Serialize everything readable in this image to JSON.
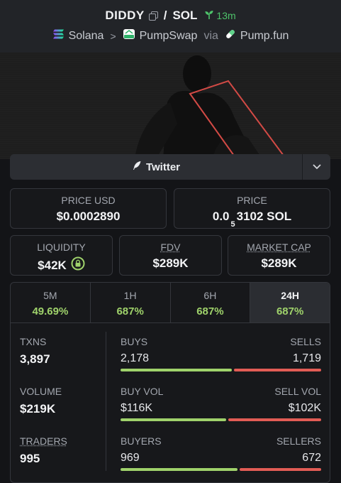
{
  "header": {
    "base_token": "DIDDY",
    "separator": "/",
    "quote_token": "SOL",
    "age": "13m",
    "chain": "Solana",
    "dex": "PumpSwap",
    "via": "via",
    "launchpad": "Pump.fun",
    "colors": {
      "age": "#4ec26a"
    }
  },
  "links": {
    "twitter_label": "Twitter"
  },
  "price_usd": {
    "label": "PRICE USD",
    "value": "$0.0002890"
  },
  "price": {
    "label": "PRICE",
    "value_prefix": "0.0",
    "value_sub": "5",
    "value_suffix": "3102 SOL"
  },
  "liquidity": {
    "label": "LIQUIDITY",
    "value": "$42K"
  },
  "fdv": {
    "label": "FDV",
    "value": "$289K"
  },
  "market_cap": {
    "label": "MARKET CAP",
    "value": "$289K"
  },
  "timeframes": [
    {
      "label": "5M",
      "change": "49.69%"
    },
    {
      "label": "1H",
      "change": "687%"
    },
    {
      "label": "6H",
      "change": "687%"
    },
    {
      "label": "24H",
      "change": "687%",
      "active": true
    }
  ],
  "stats": {
    "txns": {
      "label": "TXNS",
      "value": "3,897"
    },
    "buys": {
      "label": "BUYS",
      "value": "2,178"
    },
    "sells": {
      "label": "SELLS",
      "value": "1,719"
    },
    "txns_buy_fraction": 0.559,
    "volume": {
      "label": "VOLUME",
      "value": "$219K"
    },
    "buy_vol": {
      "label": "BUY VOL",
      "value": "$116K"
    },
    "sell_vol": {
      "label": "SELL VOL",
      "value": "$102K"
    },
    "volume_buy_fraction": 0.532,
    "traders": {
      "label": "TRADERS",
      "value": "995"
    },
    "buyers": {
      "label": "BUYERS",
      "value": "969"
    },
    "sellers": {
      "label": "SELLERS",
      "value": "672"
    },
    "traders_buy_fraction": 0.59
  },
  "colors": {
    "positive": "#9fd26b",
    "negative": "#e25c55",
    "background": "#131417"
  }
}
